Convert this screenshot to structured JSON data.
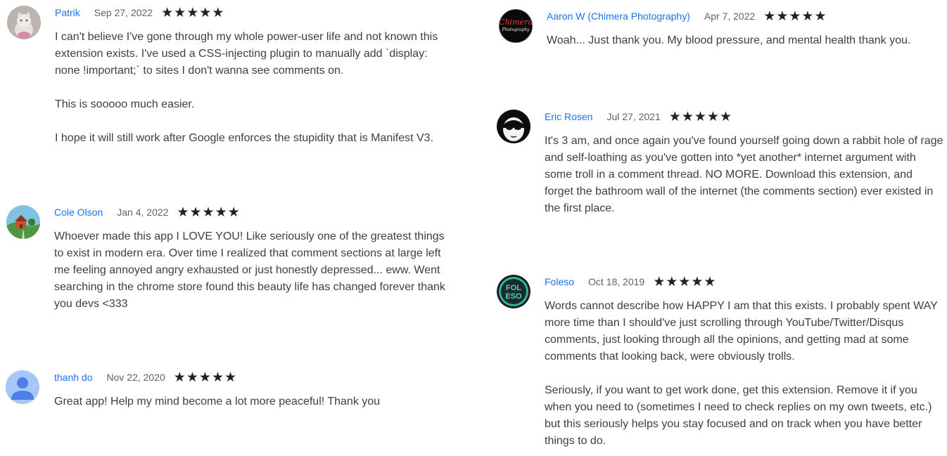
{
  "reviews": [
    {
      "author": "Patrik",
      "date": "Sep 27, 2022",
      "stars": 5,
      "avatar_icon": "kitten-photo-avatar",
      "text": "I can't believe I've gone through my whole power-user life and not known this extension exists. I've used a CSS-injecting plugin to manually add `display: none !important;` to sites I don't wanna see comments on.\n\nThis is sooooo much easier.\n\nI hope it will still work after Google enforces the stupidity that is Manifest V3."
    },
    {
      "author": "Cole Olson",
      "date": "Jan 4, 2022",
      "stars": 5,
      "avatar_icon": "house-landscape-avatar",
      "text": "Whoever made this app I LOVE YOU! Like seriously one of the greatest things to exist in modern era. Over time I realized that comment sections at large left me feeling annoyed angry exhausted or just honestly depressed... eww. Went searching in the chrome store found this beauty life has changed forever thank you devs <333"
    },
    {
      "author": "thanh do",
      "date": "Nov 22, 2020",
      "stars": 5,
      "avatar_icon": "default-person-avatar",
      "text": "Great app! Help my mind become a lot more peaceful! Thank you"
    },
    {
      "author": "Aaron W (Chimera Photography)",
      "date": "Apr 7, 2022",
      "stars": 5,
      "avatar_icon": "chimera-photography-logo-avatar",
      "avatar_logo_text": "Chimera Photography",
      "text": "Woah... Just thank you. My blood pressure, and mental health thank you."
    },
    {
      "author": "Eric Rosen",
      "date": "Jul 27, 2021",
      "stars": 5,
      "avatar_icon": "masked-face-avatar",
      "text": "It's 3 am, and once again you've found yourself going down a rabbit hole of rage and self-loathing as you've gotten into *yet another* internet argument with some troll in a comment thread. NO MORE. Download this extension, and forget the bathroom wall of the internet (the comments section) ever existed in the first place."
    },
    {
      "author": "Foleso",
      "date": "Oct 18, 2019",
      "stars": 5,
      "avatar_icon": "foleso-logo-avatar",
      "avatar_logo_text": "FOL ESO",
      "text": "Words cannot describe how HAPPY I am that this exists. I probably spent WAY more time than I should've just scrolling through YouTube/Twitter/Disqus comments, just looking through all the opinions, and getting mad at some comments that looking back, were obviously trolls.\n\nSeriously, if you want to get work done, get this extension. Remove it if you when you need to (sometimes I need to check replies on my own tweets, etc.) but this seriously helps you stay focused and on track when you have better things to do."
    }
  ],
  "colors": {
    "author_link": "#1a73e8",
    "date": "#5f6368",
    "text": "#3c4043",
    "star": "#202124"
  }
}
